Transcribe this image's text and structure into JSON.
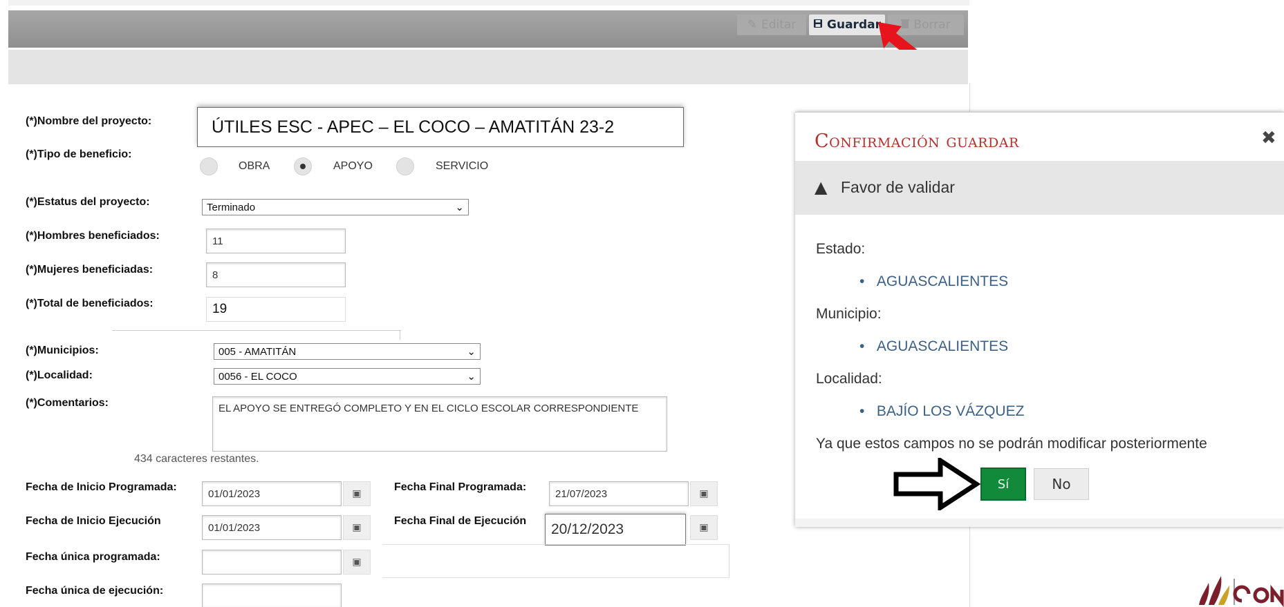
{
  "toolbar": {
    "edit_label": "Editar",
    "save_label": "Guardar",
    "delete_label": "Borrar"
  },
  "form": {
    "project_name": {
      "label": "(*)Nombre del proyecto:",
      "value": "ÚTILES ESC - APEC – EL COCO – AMATITÁN 23-2"
    },
    "benefit_type": {
      "label": "(*)Tipo de beneficio:",
      "options": [
        "OBRA",
        "APOYO",
        "SERVICIO"
      ],
      "selected": "APOYO"
    },
    "status": {
      "label": "(*)Estatus del proyecto:",
      "value": "Terminado"
    },
    "men": {
      "label": "(*)Hombres beneficiados:",
      "value": "11"
    },
    "women": {
      "label": "(*)Mujeres beneficiadas:",
      "value": "8"
    },
    "total": {
      "label": "(*)Total de beneficiados:",
      "value": "19"
    },
    "municipio": {
      "label": "(*)Municipios:",
      "value": "005 - AMATITÁN"
    },
    "localidad": {
      "label": "(*)Localidad:",
      "value": "0056 - EL COCO"
    },
    "comments": {
      "label": "(*)Comentarios:",
      "value": "EL APOYO SE ENTREGÓ COMPLETO Y EN EL CICLO ESCOLAR CORRESPONDIENTE",
      "remaining": "434 caracteres restantes."
    },
    "start_programmed": {
      "label": "Fecha de Inicio Programada:",
      "value": "01/01/2023"
    },
    "end_programmed": {
      "label": "Fecha Final Programada:",
      "value": "21/07/2023"
    },
    "start_execution": {
      "label": "Fecha de Inicio Ejecución",
      "value": "01/01/2023"
    },
    "end_execution": {
      "label": "Fecha Final de Ejecución",
      "value": "20/12/2023"
    },
    "single_programmed": {
      "label": "Fecha única programada:",
      "value": ""
    },
    "single_execution": {
      "label": "Fecha única de ejecución:",
      "value": ""
    }
  },
  "dialog": {
    "title": "Confirmación guardar",
    "warning": "Favor de validar",
    "estado_label": "Estado:",
    "estado_value": "AGUASCALIENTES",
    "municipio_label": "Municipio:",
    "municipio_value": "AGUASCALIENTES",
    "localidad_label": "Localidad:",
    "localidad_value": "BAJÍO LOS VÁZQUEZ",
    "note": "Ya que estos campos no se podrán modificar posteriormente",
    "yes_label": "Sí",
    "no_label": "No"
  },
  "colors": {
    "arrow_red": "#e8141b",
    "dialog_title": "#b3312c",
    "yes_button": "#118a3a"
  },
  "icons": [
    "pencil-icon",
    "save-icon",
    "trash-icon",
    "calendar-icon",
    "warning-icon",
    "close-icon",
    "dropdown-arrow-icon"
  ]
}
